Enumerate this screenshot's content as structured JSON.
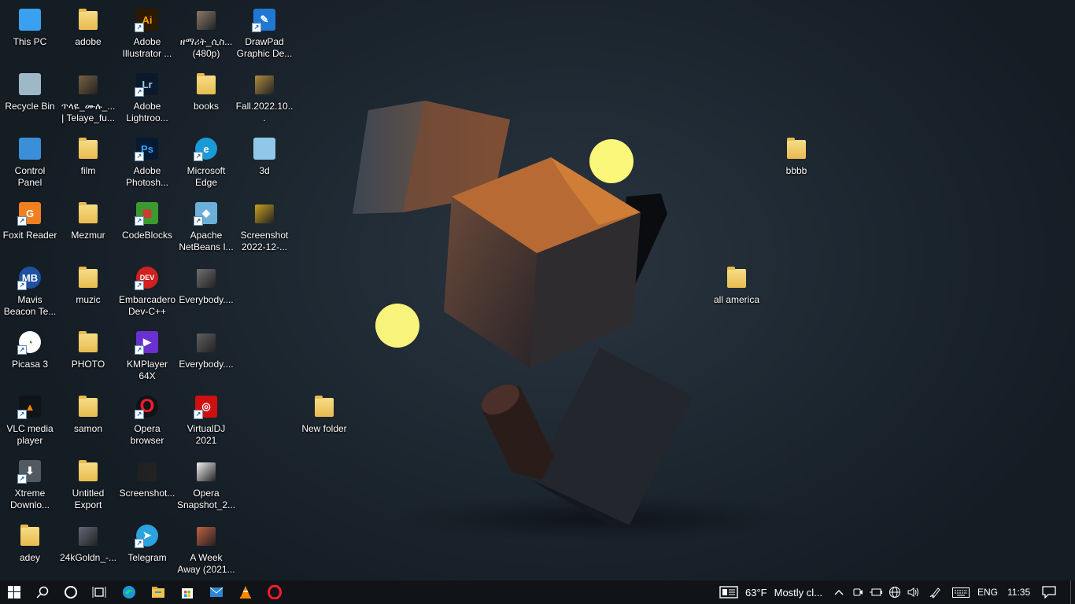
{
  "desktop": {
    "icons": [
      {
        "label": "This PC",
        "icon": "computer-icon",
        "kind": "sys",
        "color": "#3aa0f0"
      },
      {
        "label": "adobe",
        "icon": "folder-icon",
        "kind": "folder",
        "color": "#e8bb4f"
      },
      {
        "label": "Adobe\nIllustrator ...",
        "icon": "adobe-illustrator-icon",
        "kind": "app",
        "color": "#2b1a00",
        "text": "Ai",
        "fg": "#ff9a00"
      },
      {
        "label": "ዘማሪት_ሲስ...\n(480p)",
        "icon": "video-thumbnail-icon",
        "kind": "thumb",
        "color": "#8a7a6a"
      },
      {
        "label": "DrawPad\nGraphic De...",
        "icon": "drawpad-icon",
        "kind": "app",
        "color": "#1e78d4",
        "text": "✎",
        "fg": "#fff"
      },
      {
        "label": "Recycle Bin",
        "icon": "recycle-bin-icon",
        "kind": "sys",
        "color": "#9fb8c8"
      },
      {
        "label": "ጥላዬ_ሙሉ_...\n| Telaye_fu...",
        "icon": "video-thumbnail-icon",
        "kind": "thumb",
        "color": "#7a6040"
      },
      {
        "label": "Adobe\nLightroo...",
        "icon": "adobe-lightroom-icon",
        "kind": "app",
        "color": "#0b1a2a",
        "text": "Lr",
        "fg": "#9ad0f5"
      },
      {
        "label": "books",
        "icon": "folder-icon",
        "kind": "folder",
        "color": "#e8bb4f"
      },
      {
        "label": "Fall.2022.10...",
        "icon": "video-thumbnail-icon",
        "kind": "thumb",
        "color": "#b08a40"
      },
      {
        "label": "Control\nPanel",
        "icon": "control-panel-icon",
        "kind": "sys",
        "color": "#3a8fd8"
      },
      {
        "label": "film",
        "icon": "folder-icon",
        "kind": "folder",
        "color": "#e8bb4f"
      },
      {
        "label": "Adobe\nPhotosh...",
        "icon": "adobe-photoshop-icon",
        "kind": "app",
        "color": "#061a33",
        "text": "Ps",
        "fg": "#31a8ff"
      },
      {
        "label": "Microsoft\nEdge",
        "icon": "edge-icon",
        "kind": "app",
        "color": "#1a9ad6",
        "text": "e",
        "fg": "#fff"
      },
      {
        "label": "3d",
        "icon": "notepad-icon",
        "kind": "sys",
        "color": "#8fc8e8"
      },
      {
        "label": "Foxit Reader",
        "icon": "foxit-reader-icon",
        "kind": "app",
        "color": "#f08020",
        "text": "G",
        "fg": "#fff"
      },
      {
        "label": "Mezmur",
        "icon": "folder-icon",
        "kind": "folder",
        "color": "#e8bb4f"
      },
      {
        "label": "CodeBlocks",
        "icon": "codeblocks-icon",
        "kind": "app",
        "color": "#3a9a30",
        "text": "▦",
        "fg": "#e03030"
      },
      {
        "label": "Apache\nNetBeans I...",
        "icon": "netbeans-icon",
        "kind": "app",
        "color": "#6ab0d8",
        "text": "◆",
        "fg": "#fff"
      },
      {
        "label": "Screenshot\n2022-12-...",
        "icon": "image-thumbnail-icon",
        "kind": "thumb",
        "color": "#c8a020"
      },
      {
        "label": "Mavis\nBeacon Te...",
        "icon": "mavis-beacon-icon",
        "kind": "app",
        "color": "#2050a0",
        "text": "MB",
        "fg": "#fff"
      },
      {
        "label": "muzic",
        "icon": "folder-icon",
        "kind": "folder",
        "color": "#e8bb4f"
      },
      {
        "label": "Embarcadero\nDev-C++",
        "icon": "devcpp-icon",
        "kind": "app",
        "color": "#d02020",
        "text": "DEV",
        "fg": "#fff"
      },
      {
        "label": "Everybody....",
        "icon": "video-thumbnail-icon",
        "kind": "thumb",
        "color": "#707070"
      },
      {
        "label": "",
        "icon": "",
        "kind": "none",
        "color": ""
      },
      {
        "label": "Picasa 3",
        "icon": "picasa-icon",
        "kind": "app",
        "color": "#ffffff",
        "text": "◔",
        "fg": "#3a9a30"
      },
      {
        "label": "PHOTO",
        "icon": "folder-icon",
        "kind": "folder",
        "color": "#e8bb4f"
      },
      {
        "label": "KMPlayer\n64X",
        "icon": "kmplayer-icon",
        "kind": "app",
        "color": "#6a30d0",
        "text": "▶",
        "fg": "#fff"
      },
      {
        "label": "Everybody....",
        "icon": "video-thumbnail-icon",
        "kind": "thumb",
        "color": "#606060"
      },
      {
        "label": "",
        "icon": "",
        "kind": "none",
        "color": ""
      },
      {
        "label": "VLC media\nplayer",
        "icon": "vlc-icon",
        "kind": "app",
        "color": "#0f1418",
        "text": "▲",
        "fg": "#ff8800"
      },
      {
        "label": "samon",
        "icon": "folder-icon",
        "kind": "folder",
        "color": "#e8bb4f"
      },
      {
        "label": "Opera\nbrowser",
        "icon": "opera-icon",
        "kind": "app",
        "color": "#0f1418",
        "text": "O",
        "fg": "#ff1b2d"
      },
      {
        "label": "VirtualDJ\n2021",
        "icon": "virtualdj-icon",
        "kind": "app",
        "color": "#d01010",
        "text": "◎",
        "fg": "#fff"
      },
      {
        "label": "New folder",
        "icon": "folder-icon",
        "kind": "folder",
        "color": "#e8bb4f"
      },
      {
        "label": "Xtreme\nDownlo...",
        "icon": "xtreme-download-icon",
        "kind": "app",
        "color": "#505a60",
        "text": "⬇",
        "fg": "#fff"
      },
      {
        "label": "Untitled\nExport",
        "icon": "folder-icon",
        "kind": "folder",
        "color": "#e8bb4f"
      },
      {
        "label": "Screenshot...",
        "icon": "image-thumbnail-icon",
        "kind": "thumb",
        "color": "#202020"
      },
      {
        "label": "Opera\nSnapshot_2...",
        "icon": "document-thumbnail-icon",
        "kind": "thumb",
        "color": "#f0f0f0"
      },
      {
        "label": "",
        "icon": "",
        "kind": "none",
        "color": ""
      },
      {
        "label": "adey",
        "icon": "folder-icon",
        "kind": "folder",
        "color": "#e8bb4f"
      },
      {
        "label": "24kGoldn_-...",
        "icon": "video-thumbnail-icon",
        "kind": "thumb",
        "color": "#606878"
      },
      {
        "label": "Telegram",
        "icon": "telegram-icon",
        "kind": "app",
        "color": "#2aa3e0",
        "text": "➤",
        "fg": "#fff"
      },
      {
        "label": "A Week\nAway (2021...",
        "icon": "video-thumbnail-icon",
        "kind": "thumb",
        "color": "#c06040"
      },
      {
        "label": "",
        "icon": "",
        "kind": "none",
        "color": ""
      }
    ],
    "free_icons": [
      {
        "label": "bbbb",
        "icon": "folder-icon"
      },
      {
        "label": "all america",
        "icon": "folder-icon"
      }
    ]
  },
  "taskbar": {
    "pinned": [
      {
        "name": "start-button",
        "icon": "windows-logo-icon"
      },
      {
        "name": "search-button",
        "icon": "search-icon"
      },
      {
        "name": "cortana-button",
        "icon": "cortana-circle-icon"
      },
      {
        "name": "task-view-button",
        "icon": "task-view-icon"
      },
      {
        "name": "taskbar-edge",
        "icon": "edge-icon"
      },
      {
        "name": "taskbar-file-explorer",
        "icon": "file-explorer-icon"
      },
      {
        "name": "taskbar-store",
        "icon": "microsoft-store-icon"
      },
      {
        "name": "taskbar-mail",
        "icon": "mail-icon"
      },
      {
        "name": "taskbar-vlc",
        "icon": "vlc-icon"
      },
      {
        "name": "taskbar-opera",
        "icon": "opera-icon"
      }
    ],
    "weather": {
      "temp": "63°F",
      "condition": "Mostly cl..."
    },
    "language": "ENG",
    "time": "11:35"
  }
}
